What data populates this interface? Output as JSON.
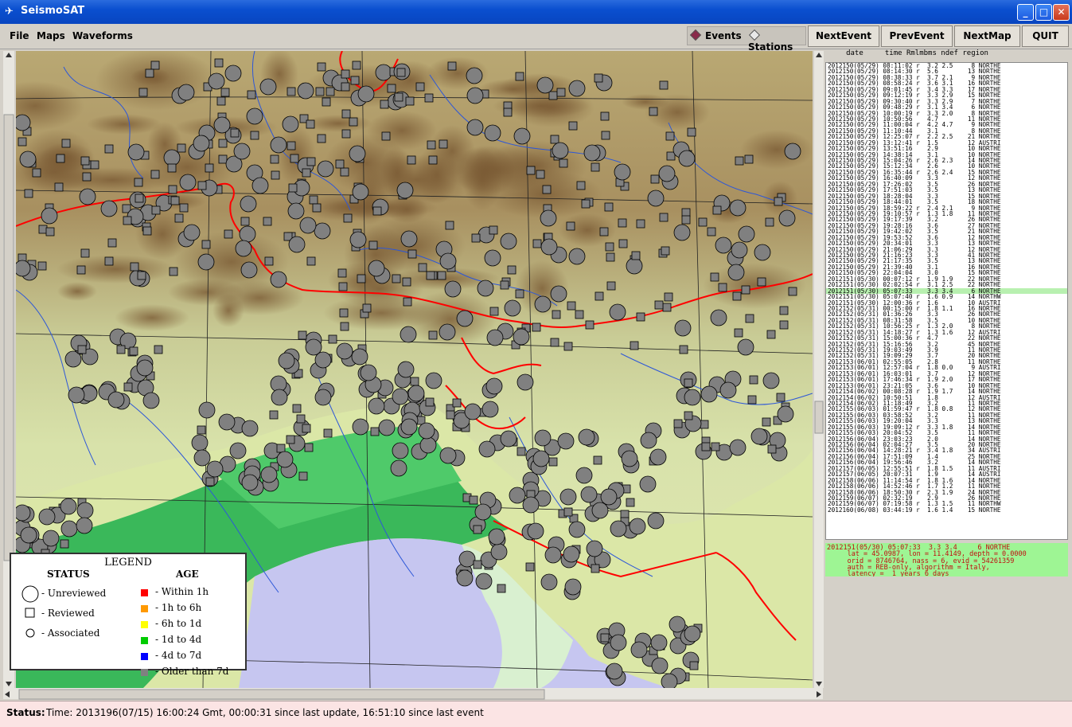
{
  "window": {
    "title": "SeismoSAT",
    "buttons": {
      "minimize": "_",
      "maximize": "□",
      "close": "✕"
    }
  },
  "menu": {
    "file": "File",
    "maps": "Maps",
    "waveforms": "Waveforms"
  },
  "toggle": {
    "events": "Events",
    "stations": "Stations",
    "selected": "events"
  },
  "toolbar": {
    "next_event": "NextEvent",
    "prev_event": "PrevEvent",
    "next_map": "NextMap",
    "quit": "QUIT"
  },
  "list_header": "     date     time Rmlmbms ndef region",
  "events": [
    "2012150(05/29) 08:11:02 r  3.2 2.5     8 NORTHE",
    "2012150(05/29) 08:14:30 r  5.6        13 NORTHE",
    "2012150(05/29) 08:38:33 r  3.7 2.1     9 NORTHE",
    "2012150(05/29) 08:58:24 r  3.6 3.1    16 NORTHE",
    "2012150(05/29) 09:01:45 r  3.4 3.3    17 NORTHE",
    "2012150(05/29) 09:12:19 r  3.3 2.9    15 NORTHE",
    "2012150(05/29) 09:30:40 r  3.3 2.9     7 NORTHE",
    "2012150(05/29) 09:48:29 r  3.1 3.4     6 NORTHE",
    "2012150(05/29) 10:00:19 r  3.3 2.0     8 NORTHE",
    "2012150(05/29) 10:50:56    4.7        11 NORTHE",
    "2012150(05/29) 11:00:04 r  4.2 4.7     9 NORTHE",
    "2012150(05/29) 11:10:44    3.1         8 NORTHE",
    "2012150(05/29) 12:25:07 r  2.2 2.5    21 NORTHE",
    "2012150(05/29) 13:12:41 r  1.5        12 AUSTRI",
    "2012150(05/29) 13:51:16    2.9        10 NORTHE",
    "2012150(05/29) 14:38:14    3.1        10 NORTHE",
    "2012150(05/29) 15:04:26 r  2.6 2.3    14 NORTHE",
    "2012150(05/29) 15:12:34    2.6        10 NORTHE",
    "2012150(05/29) 16:35:44 r  2.6 2.4    15 NORTHE",
    "2012150(05/29) 16:40:09    3.3        12 NORTHE",
    "2012150(05/29) 17:26:02    3.5        26 NORTHE",
    "2012150(05/29) 17:51:03    3.5        13 NORTHE",
    "2012150(05/29) 18:28:04    3.3        15 NORTHE",
    "2012150(05/29) 18:44:01    3.5        18 NORTHE",
    "2012150(05/29) 18:59:22 r  2.4 2.1     9 NORTHE",
    "2012150(05/29) 19:10:57 r  1.3 1.8    11 NORTHE",
    "2012150(05/29) 19:17:39    3.2        26 NORTHE",
    "2012150(05/29) 19:28:16    3.6        27 NORTHE",
    "2012150(05/29) 19:42:02    3.5        21 NORTHE",
    "2012150(05/29) 19:53:52    3.6        12 NORTHE",
    "2012150(05/29) 20:34:01    3.3        13 NORTHE",
    "2012150(05/29) 21:06:29    3.3        12 NORTHE",
    "2012150(05/29) 21:16:23    3.3        41 NORTHE",
    "2012150(05/29) 21:17:35    3.5        13 NORTHE",
    "2012150(05/29) 21:39:40    3.1        16 NORTHE",
    "2012150(05/29) 22:04:04    3.0        15 NORTHE",
    "2012151(05/30) 00:07:12 r  1.9 1.9    22 NORTHE",
    "2012151(05/30) 02:02:54 r  3.1 2.5    22 NORTHE",
    "2012151(05/30) 05:07:33    3.3 3.4     6 NORTHE",
    "2012151(05/30) 05:07:40 r  1.6 0.9    14 NORTHW",
    "2012151(05/30) 12:00:36 r  1.6        10 AUSTRI",
    "2012152(05/31) 00:15:00 r  1.8 1.1    16 NORTHE",
    "2012152(05/31) 01:36:26    3.3        26 NORTHE",
    "2012152(05/31) 08:31:58    3.5        10 NORTHE",
    "2012152(05/31) 10:56:25 r  1.3 2.0     8 NORTHE",
    "2012152(05/31) 14:18:27 r  1.3 1.6    12 AUSTRI",
    "2012152(05/31) 15:00:36 r  4.7        22 NORTHE",
    "2012152(05/31) 15:16:56    3.2        45 NORTHE",
    "2012152(05/31) 19:03:49    3.9        11 NORTHE",
    "2012152(05/31) 19:09:29    3.7        20 NORTHE",
    "2012153(06/01) 02:55:05    2.8        11 NORTHE",
    "2012153(06/01) 12:57:04 r  1.8 0.0     9 AUSTRI",
    "2012153(06/01) 16:03:01    3.7        12 NORTHE",
    "2012153(06/01) 17:46:34 r  1.9 2.0    17 NORTHE",
    "2012153(06/01) 23:21:05    3.6        10 NORTHE",
    "2012154(06/02) 00:08:28 r  1.9 1.7    14 NORTHE",
    "2012154(06/02) 10:50:51    1.8        12 AUSTRI",
    "2012154(06/02) 11:18:49    3.2        11 NORTHE",
    "2012155(06/03) 01:59:47 r  1.8 0.8    12 NORTHE",
    "2012155(06/03) 03:58:52    3.2        11 NORTHE",
    "2012155(06/03) 19:20:04    3.3        13 NORTHE",
    "2012155(06/03) 19:09:12 r  3.3 1.8    14 NORTHE",
    "2012155(06/03) 20:04:52    3.5        11 NORTHE",
    "2012156(06/04) 23:03:23    2.0        14 NORTHE",
    "2012156(06/04) 02:04:27    3.5        20 NORTHE",
    "2012156(06/04) 14:28:21 r  3.4 1.8    34 AUSTRI",
    "2012156(06/04) 17:51:09    1.4        25 NORTHE",
    "2012156(06/04) 19:56:46    3.2        14 NORTHE",
    "2012157(06/05) 12:55:51 r  1.8 1.5    11 AUSTRI",
    "2012157(06/05) 20:07:31    1.9        14 AUSTRI",
    "2012158(06/06) 11:14:54 r  1.8 1.6    14 NORTHE",
    "2012158(06/06) 14:52:46 r  1.7 1.2    11 NORTHE",
    "2012158(06/06) 18:50:30 r  2.3 1.9    24 NORTHE",
    "2012159(06/07) 02:32:19    2.9        26 NORTHE",
    "2012159(06/07) 07:19:58 r  1.3 1.5    11 NORTHW",
    "2012160(06/08) 03:44:19 r  1.6 1.4    15 NORTHE"
  ],
  "selected_index": 38,
  "detail": [
    "2012151(05/30) 05:07:33  3.3 3.4     6 NORTHE",
    "     lat = 45.0987, lon = 11.4149, depth = 0.0000",
    "     orid = 8746764, nass = 6, evid = 54261359",
    "     auth = REB-only, algorithm = Italy,",
    "     latency =  1 years 6 days"
  ],
  "legend": {
    "title": "LEGEND",
    "status_title": "STATUS",
    "age_title": "AGE",
    "status": [
      "- Unreviewed",
      "- Reviewed",
      "- Associated"
    ],
    "age": [
      {
        "label": "- Within 1h",
        "color": "#ff0000"
      },
      {
        "label": "- 1h to 6h",
        "color": "#ff9900"
      },
      {
        "label": "- 6h to 1d",
        "color": "#ffff00"
      },
      {
        "label": "- 1d to 4d",
        "color": "#00cc00"
      },
      {
        "label": "- 4d to 7d",
        "color": "#0000ff"
      },
      {
        "label": "- Older than 7d",
        "color": "#808080"
      }
    ]
  },
  "status": {
    "label": "Status:",
    "text": "Time: 2013196(07/15) 16:00:24 Gmt, 00:00:31 since last update, 16:51:10 since last event"
  }
}
